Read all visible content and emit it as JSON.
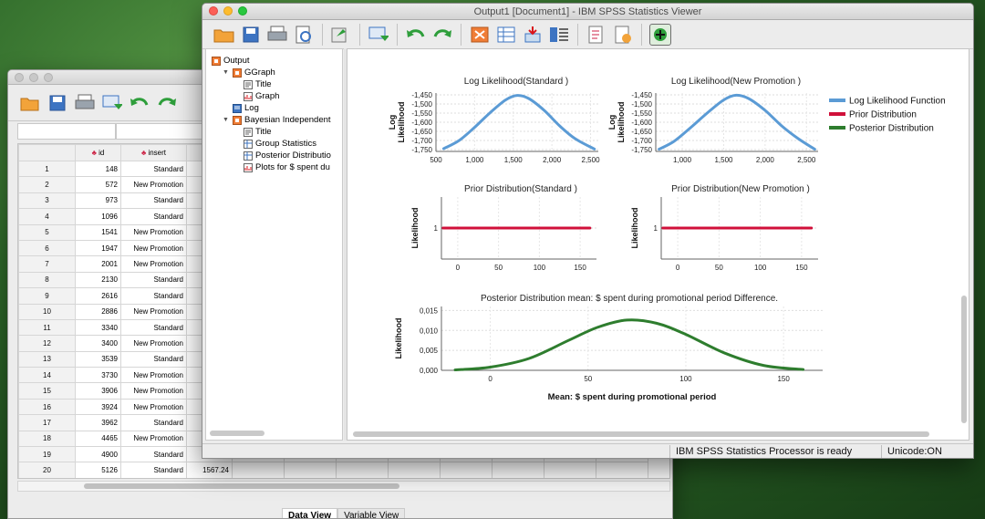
{
  "data_editor": {
    "columns": {
      "id": "id",
      "insert": "insert"
    },
    "rows": [
      {
        "n": "1",
        "id": "148",
        "insert": "Standard"
      },
      {
        "n": "2",
        "id": "572",
        "insert": "New Promotion"
      },
      {
        "n": "3",
        "id": "973",
        "insert": "Standard"
      },
      {
        "n": "4",
        "id": "1096",
        "insert": "Standard"
      },
      {
        "n": "5",
        "id": "1541",
        "insert": "New Promotion"
      },
      {
        "n": "6",
        "id": "1947",
        "insert": "New Promotion"
      },
      {
        "n": "7",
        "id": "2001",
        "insert": "New Promotion"
      },
      {
        "n": "8",
        "id": "2130",
        "insert": "Standard"
      },
      {
        "n": "9",
        "id": "2616",
        "insert": "Standard"
      },
      {
        "n": "10",
        "id": "2886",
        "insert": "New Promotion"
      },
      {
        "n": "11",
        "id": "3340",
        "insert": "Standard"
      },
      {
        "n": "12",
        "id": "3400",
        "insert": "New Promotion"
      },
      {
        "n": "13",
        "id": "3539",
        "insert": "Standard"
      },
      {
        "n": "14",
        "id": "3730",
        "insert": "New Promotion"
      },
      {
        "n": "15",
        "id": "3906",
        "insert": "New Promotion"
      },
      {
        "n": "16",
        "id": "3924",
        "insert": "New Promotion"
      },
      {
        "n": "17",
        "id": "3962",
        "insert": "Standard"
      },
      {
        "n": "18",
        "id": "4465",
        "insert": "New Promotion"
      },
      {
        "n": "19",
        "id": "4900",
        "insert": "Standard"
      },
      {
        "n": "20",
        "id": "5126",
        "insert": "Standard",
        "spent": "1567.24"
      }
    ],
    "tabs": [
      "Data View",
      "Variable View"
    ]
  },
  "viewer": {
    "title": "Output1 [Document1] - IBM SPSS Statistics Viewer",
    "outline": [
      {
        "label": "Output",
        "icon": "output-book-icon",
        "level": 0,
        "twisty": ""
      },
      {
        "label": "GGraph",
        "icon": "output-book-icon",
        "level": 1,
        "twisty": "▼"
      },
      {
        "label": "Title",
        "icon": "title-page-icon",
        "level": 2,
        "twisty": ""
      },
      {
        "label": "Graph",
        "icon": "graph-page-icon",
        "level": 2,
        "twisty": ""
      },
      {
        "label": "Log",
        "icon": "log-page-icon",
        "level": 1,
        "twisty": ""
      },
      {
        "label": "Bayesian Independent",
        "icon": "output-book-icon",
        "level": 1,
        "twisty": "▼"
      },
      {
        "label": "Title",
        "icon": "title-page-icon",
        "level": 2,
        "twisty": ""
      },
      {
        "label": "Group Statistics",
        "icon": "table-page-icon",
        "level": 2,
        "twisty": ""
      },
      {
        "label": "Posterior Distributio",
        "icon": "table-page-icon",
        "level": 2,
        "twisty": ""
      },
      {
        "label": "Plots for $ spent du",
        "icon": "graph-page-icon",
        "level": 2,
        "twisty": ""
      }
    ],
    "status": {
      "processor": "IBM SPSS Statistics Processor is ready",
      "unicode": "Unicode:ON"
    }
  },
  "colors": {
    "likelihood": "#5b9bd5",
    "prior": "#d0103a",
    "posterior": "#2e7d2e"
  },
  "chart_data": [
    {
      "type": "line",
      "title": "Log Likelihood(Standard )",
      "ylabel": "Log Likelihood",
      "x_ticks": [
        "500",
        "1,000",
        "1,500",
        "2,000",
        "2,500"
      ],
      "y_ticks": [
        "-1,450",
        "-1,500",
        "-1,550",
        "-1,600",
        "-1,650",
        "-1,700",
        "-1,750"
      ],
      "xlim": [
        500,
        2600
      ],
      "ylim": [
        -1760,
        -1440
      ],
      "series": [
        {
          "name": "Log Likelihood Function",
          "x": [
            600,
            800,
            1000,
            1200,
            1400,
            1550,
            1700,
            1900,
            2100,
            2300,
            2550
          ],
          "y": [
            -1745,
            -1700,
            -1628,
            -1548,
            -1478,
            -1453,
            -1470,
            -1535,
            -1620,
            -1690,
            -1747
          ]
        }
      ]
    },
    {
      "type": "line",
      "title": "Log Likelihood(New Promotion )",
      "ylabel": "Log Likelihood",
      "x_ticks": [
        "1,000",
        "1,500",
        "2,000",
        "2,500"
      ],
      "y_ticks": [
        "-1,450",
        "-1,500",
        "-1,550",
        "-1,600",
        "-1,650",
        "-1,700",
        "-1,750"
      ],
      "xlim": [
        680,
        2640
      ],
      "ylim": [
        -1760,
        -1440
      ],
      "series": [
        {
          "name": "Log Likelihood Function",
          "x": [
            720,
            900,
            1100,
            1300,
            1500,
            1650,
            1800,
            2000,
            2200,
            2400,
            2600
          ],
          "y": [
            -1748,
            -1705,
            -1630,
            -1550,
            -1478,
            -1452,
            -1470,
            -1535,
            -1620,
            -1690,
            -1748
          ]
        }
      ]
    },
    {
      "type": "line",
      "title": "Prior Distribution(Standard )",
      "ylabel": "Likelihood",
      "x_ticks": [
        "0",
        "50",
        "100",
        "150"
      ],
      "y_ticks": [
        "1"
      ],
      "xlim": [
        -20,
        170
      ],
      "ylim": [
        0,
        2
      ],
      "series": [
        {
          "name": "Prior Distribution",
          "x": [
            -18,
            162
          ],
          "y": [
            1,
            1
          ]
        }
      ]
    },
    {
      "type": "line",
      "title": "Prior Distribution(New Promotion )",
      "ylabel": "Likelihood",
      "x_ticks": [
        "0",
        "50",
        "100",
        "150"
      ],
      "y_ticks": [
        "1"
      ],
      "xlim": [
        -20,
        170
      ],
      "ylim": [
        0,
        2
      ],
      "series": [
        {
          "name": "Prior Distribution",
          "x": [
            -18,
            162
          ],
          "y": [
            1,
            1
          ]
        }
      ]
    },
    {
      "type": "line",
      "title": "Posterior Distribution mean: $ spent during promotional period Difference.",
      "xlabel": "Mean: $ spent during promotional period",
      "ylabel": "Likelihood",
      "x_ticks": [
        "0",
        "50",
        "100",
        "150"
      ],
      "y_ticks": [
        "0,000",
        "0,005",
        "0,010",
        "0,015"
      ],
      "xlim": [
        -25,
        170
      ],
      "ylim": [
        0,
        0.016
      ],
      "series": [
        {
          "name": "Posterior Distribution",
          "x": [
            -18,
            0,
            20,
            40,
            55,
            70,
            85,
            100,
            120,
            140,
            160
          ],
          "y": [
            0.0001,
            0.0008,
            0.003,
            0.0075,
            0.0108,
            0.0126,
            0.0118,
            0.009,
            0.0043,
            0.0012,
            0.0002
          ]
        }
      ]
    }
  ],
  "legend": [
    {
      "name": "Log Likelihood Function",
      "color": "#5b9bd5"
    },
    {
      "name": "Prior Distribution",
      "color": "#d0103a"
    },
    {
      "name": "Posterior Distribution",
      "color": "#2e7d2e"
    }
  ]
}
